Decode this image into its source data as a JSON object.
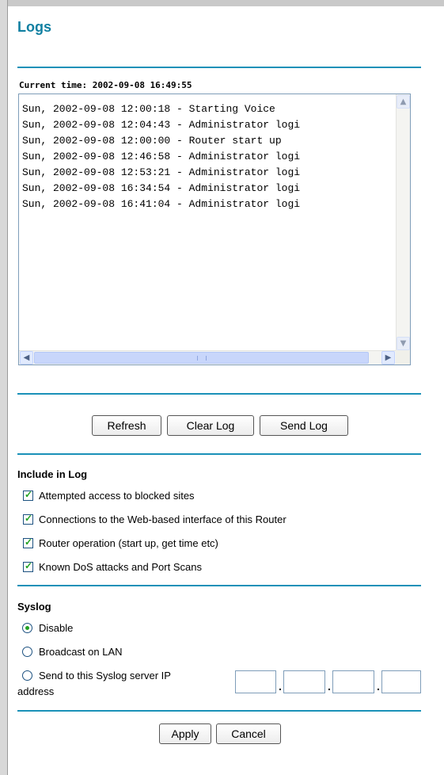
{
  "page": {
    "title": "Logs"
  },
  "log": {
    "current_time": "Current time: 2002-09-08 16:49:55",
    "entries": [
      "Sun, 2002-09-08 12:00:18 - Starting Voice",
      "Sun, 2002-09-08 12:04:43 - Administrator logi",
      "Sun, 2002-09-08 12:00:00 - Router start up",
      "Sun, 2002-09-08 12:46:58 - Administrator logi",
      "Sun, 2002-09-08 12:53:21 - Administrator logi",
      "Sun, 2002-09-08 16:34:54 - Administrator logi",
      "Sun, 2002-09-08 16:41:04 - Administrator logi"
    ]
  },
  "buttons": {
    "refresh": "Refresh",
    "clear_log": "Clear Log",
    "send_log": "Send Log",
    "apply": "Apply",
    "cancel": "Cancel"
  },
  "include_in_log": {
    "heading": "Include in Log",
    "options": [
      {
        "label": "Attempted access to blocked sites",
        "checked": true
      },
      {
        "label": "Connections to the Web-based interface of this Router",
        "checked": true
      },
      {
        "label": "Router operation (start up, get time etc)",
        "checked": true
      },
      {
        "label": "Known DoS attacks and Port Scans",
        "checked": true
      }
    ]
  },
  "syslog": {
    "heading": "Syslog",
    "options": [
      {
        "label": "Disable",
        "selected": true
      },
      {
        "label": "Broadcast on LAN",
        "selected": false
      },
      {
        "label": "Send to this Syslog server IP",
        "selected": false
      }
    ],
    "option3_continuation": "address",
    "ip": [
      "",
      "",
      "",
      ""
    ],
    "ip_separator": "."
  },
  "icons": {
    "scroll_up": "triangle-up-icon",
    "scroll_down": "triangle-down-icon",
    "scroll_left": "triangle-left-icon",
    "scroll_right": "triangle-right-icon",
    "checkmark": "checkmark-icon"
  },
  "colors": {
    "accent": "#1a91b8",
    "title": "#0f7fa1",
    "check": "#21a121"
  }
}
